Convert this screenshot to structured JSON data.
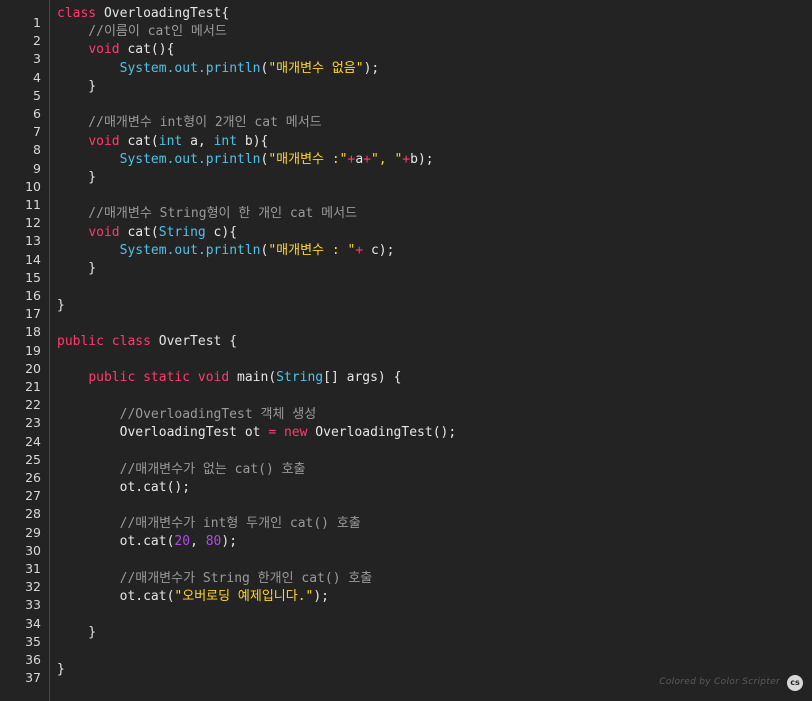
{
  "line_numbers": [
    "1",
    "2",
    "3",
    "4",
    "5",
    "6",
    "7",
    "8",
    "9",
    "10",
    "11",
    "12",
    "13",
    "14",
    "15",
    "16",
    "17",
    "18",
    "19",
    "20",
    "21",
    "22",
    "23",
    "24",
    "25",
    "26",
    "27",
    "28",
    "29",
    "30",
    "31",
    "32",
    "33",
    "34",
    "35",
    "36",
    "37"
  ],
  "code_lines": [
    [
      {
        "t": "kw",
        "v": "class"
      },
      {
        "t": "plain",
        "v": " OverloadingTest{"
      }
    ],
    [
      {
        "t": "cm",
        "v": "    //이름이 cat인 메서드"
      }
    ],
    [
      {
        "t": "plain",
        "v": "    "
      },
      {
        "t": "kw",
        "v": "void"
      },
      {
        "t": "plain",
        "v": " cat(){"
      }
    ],
    [
      {
        "t": "plain",
        "v": "        "
      },
      {
        "t": "type",
        "v": "System.out.println"
      },
      {
        "t": "plain",
        "v": "("
      },
      {
        "t": "str",
        "v": "\"매개변수 없음\""
      },
      {
        "t": "plain",
        "v": ");"
      }
    ],
    [
      {
        "t": "plain",
        "v": "    }"
      }
    ],
    [],
    [
      {
        "t": "cm",
        "v": "    //매개변수 int형이 2개인 cat 메서드"
      }
    ],
    [
      {
        "t": "plain",
        "v": "    "
      },
      {
        "t": "kw",
        "v": "void"
      },
      {
        "t": "plain",
        "v": " cat("
      },
      {
        "t": "type",
        "v": "int"
      },
      {
        "t": "plain",
        "v": " a, "
      },
      {
        "t": "type",
        "v": "int"
      },
      {
        "t": "plain",
        "v": " b){"
      }
    ],
    [
      {
        "t": "plain",
        "v": "        "
      },
      {
        "t": "type",
        "v": "System.out.println"
      },
      {
        "t": "plain",
        "v": "("
      },
      {
        "t": "str",
        "v": "\"매개변수 :\""
      },
      {
        "t": "op",
        "v": "+"
      },
      {
        "t": "plain",
        "v": "a"
      },
      {
        "t": "op",
        "v": "+"
      },
      {
        "t": "str",
        "v": "\", \""
      },
      {
        "t": "op",
        "v": "+"
      },
      {
        "t": "plain",
        "v": "b);"
      }
    ],
    [
      {
        "t": "plain",
        "v": "    }"
      }
    ],
    [],
    [
      {
        "t": "cm",
        "v": "    //매개변수 String형이 한 개인 cat 메서드"
      }
    ],
    [
      {
        "t": "plain",
        "v": "    "
      },
      {
        "t": "kw",
        "v": "void"
      },
      {
        "t": "plain",
        "v": " cat("
      },
      {
        "t": "type",
        "v": "String"
      },
      {
        "t": "plain",
        "v": " c){"
      }
    ],
    [
      {
        "t": "plain",
        "v": "        "
      },
      {
        "t": "type",
        "v": "System.out.println"
      },
      {
        "t": "plain",
        "v": "("
      },
      {
        "t": "str",
        "v": "\"매개변수 : \""
      },
      {
        "t": "op",
        "v": "+"
      },
      {
        "t": "plain",
        "v": " c);"
      }
    ],
    [
      {
        "t": "plain",
        "v": "    }"
      }
    ],
    [],
    [
      {
        "t": "plain",
        "v": "}"
      }
    ],
    [],
    [
      {
        "t": "kw",
        "v": "public class"
      },
      {
        "t": "plain",
        "v": " OverTest {"
      }
    ],
    [],
    [
      {
        "t": "plain",
        "v": "    "
      },
      {
        "t": "kw",
        "v": "public static void"
      },
      {
        "t": "plain",
        "v": " main("
      },
      {
        "t": "type",
        "v": "String"
      },
      {
        "t": "plain",
        "v": "[] args) {"
      }
    ],
    [],
    [
      {
        "t": "cm",
        "v": "        //OverloadingTest 객체 생성"
      }
    ],
    [
      {
        "t": "plain",
        "v": "        OverloadingTest ot "
      },
      {
        "t": "op",
        "v": "="
      },
      {
        "t": "plain",
        "v": " "
      },
      {
        "t": "kw",
        "v": "new"
      },
      {
        "t": "plain",
        "v": " OverloadingTest();"
      }
    ],
    [],
    [
      {
        "t": "cm",
        "v": "        //매개변수가 없는 cat() 호출"
      }
    ],
    [
      {
        "t": "plain",
        "v": "        ot.cat();"
      }
    ],
    [],
    [
      {
        "t": "cm",
        "v": "        //매개변수가 int형 두개인 cat() 호출"
      }
    ],
    [
      {
        "t": "plain",
        "v": "        ot.cat("
      },
      {
        "t": "num",
        "v": "20"
      },
      {
        "t": "plain",
        "v": ", "
      },
      {
        "t": "num",
        "v": "80"
      },
      {
        "t": "plain",
        "v": ");"
      }
    ],
    [],
    [
      {
        "t": "cm",
        "v": "        //매개변수가 String 한개인 cat() 호출"
      }
    ],
    [
      {
        "t": "plain",
        "v": "        ot.cat("
      },
      {
        "t": "str",
        "v": "\"오버로딩 예제입니다.\""
      },
      {
        "t": "plain",
        "v": ");"
      }
    ],
    [],
    [
      {
        "t": "plain",
        "v": "    }"
      }
    ],
    [],
    [
      {
        "t": "plain",
        "v": "}"
      }
    ]
  ],
  "footer": {
    "credit_text": "Colored by Color Scripter",
    "badge_text": "cs"
  },
  "colors": {
    "background": "#232323",
    "keyword": "#ff3b6d",
    "type": "#4fc3e8",
    "string": "#ffd52e",
    "number": "#b14be8",
    "comment": "#9a9a9a"
  }
}
